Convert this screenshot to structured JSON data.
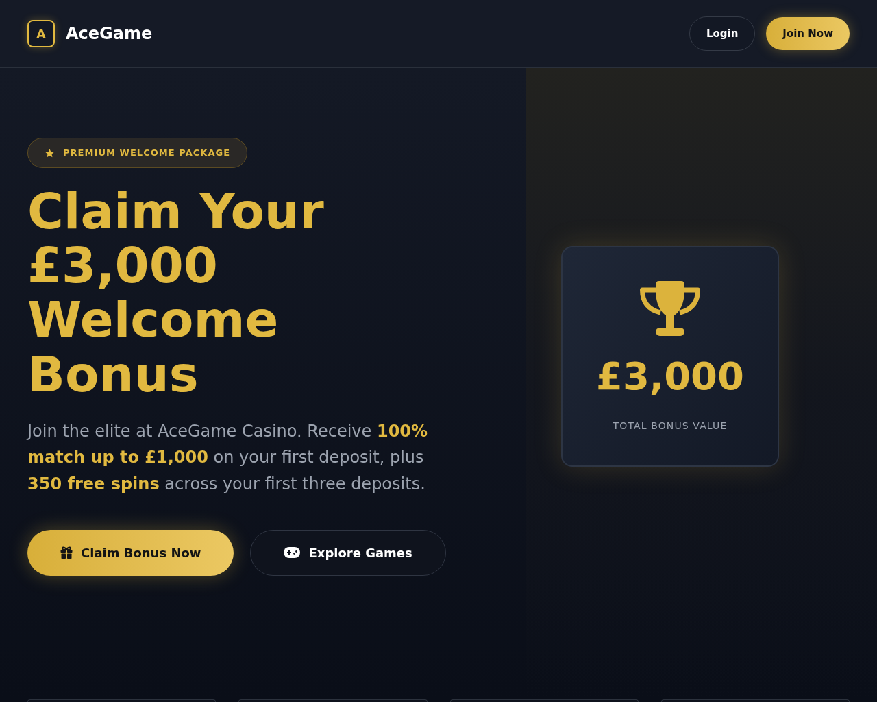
{
  "header": {
    "logo": {
      "letter": "A",
      "name": "AceGame"
    },
    "buttons": [
      {
        "label": "Login",
        "kind": "outline"
      },
      {
        "label": "Join Now",
        "kind": "primary"
      }
    ]
  },
  "hero": {
    "badge": "PREMIUM WELCOME PACKAGE",
    "heading": "Claim Your £3,000 Welcome Bonus",
    "description": "Join the elite at AceGame Casino. Receive **100% match up to £1,000** on your first deposit, plus **350 free spins** across your first three deposits.",
    "buttons": [
      {
        "label": "Claim Bonus Now",
        "kind": "primary"
      },
      {
        "label": "Explore Games",
        "kind": "outline"
      }
    ]
  },
  "bonus_card": {
    "amount": "£3,000",
    "label": "TOTAL BONUS VALUE"
  }
}
